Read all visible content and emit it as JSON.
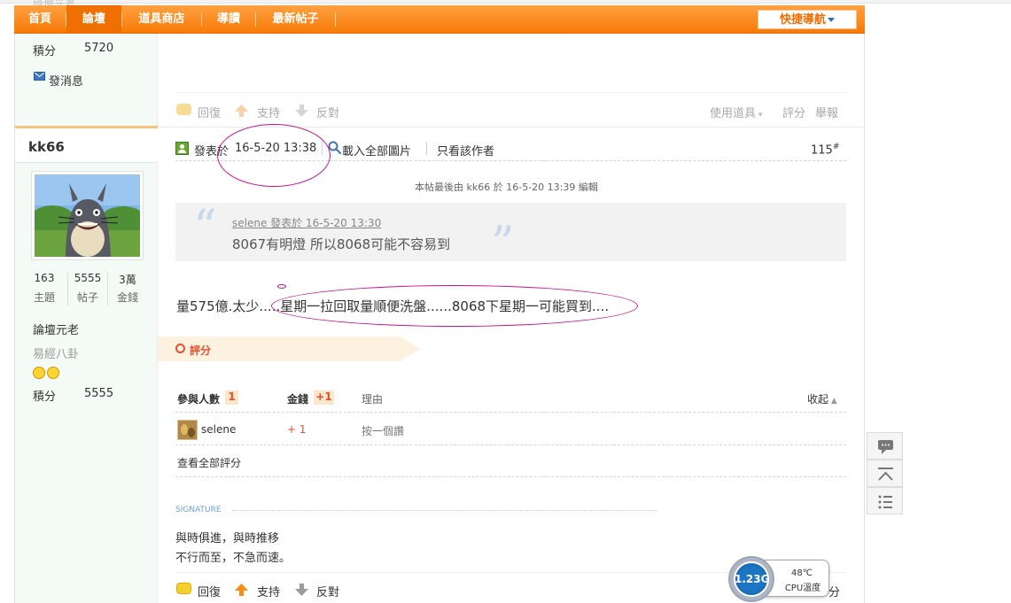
{
  "ghost_text": "論壇元老",
  "nav": {
    "items": [
      {
        "label": "首頁"
      },
      {
        "label": "論壇"
      },
      {
        "label": "道具商店"
      },
      {
        "label": "導讀"
      },
      {
        "label": "最新帖子"
      }
    ],
    "quick_nav": "快捷導航"
  },
  "prev_user": {
    "points_label": "積分",
    "points_value": "5720",
    "message_label": "發消息"
  },
  "prev_post_actions": {
    "reply": "回復",
    "support": "支持",
    "oppose": "反對",
    "use_item": "使用道具",
    "rate": "評分",
    "report": "舉報"
  },
  "user": {
    "name": "kk66",
    "stats": [
      {
        "value": "163",
        "label": "主題"
      },
      {
        "value": "5555",
        "label": "帖子"
      },
      {
        "value": "3萬",
        "label": "金錢"
      }
    ],
    "rank": "論壇元老",
    "group": "易經八卦",
    "points_label": "積分",
    "points_value": "5555"
  },
  "post": {
    "posted_label": "發表於",
    "posted_time": "16-5-20 13:38",
    "load_images": "載入全部圖片",
    "only_author": "只看該作者",
    "floor": "115",
    "floor_suffix": "#",
    "edited_note": "本帖最後由 kk66 於 16-5-20 13:39 編輯",
    "quote_meta": "selene 發表於 16-5-20 13:30",
    "quote_text": "8067有明燈 所以8068可能不容易到",
    "body_prefix": "量575億.太少.....",
    "body_highlight": "星期一拉回取量順便洗盤......8068下星期一可能買到...."
  },
  "rating": {
    "title": "評分",
    "headers": {
      "participants": "參與人數",
      "participants_count": "1",
      "money": "金錢",
      "money_count": "+1",
      "reason": "理由",
      "collapse": "收起"
    },
    "rows": [
      {
        "user": "selene",
        "money": "+ 1",
        "reason": "按一個讚"
      }
    ],
    "view_all": "查看全部評分"
  },
  "signature": {
    "label": "SIGNATURE",
    "line1": "與時俱進，與時推移",
    "line2": "不行而至，不急而速。"
  },
  "bottom_actions": {
    "reply": "回復",
    "support": "支持",
    "oppose": "反對",
    "rate_fragment": "分"
  },
  "cpu": {
    "frequency": "1.23G",
    "temperature": "48℃",
    "label": "CPU溫度"
  },
  "colors": {
    "nav_orange": "#f77a06",
    "accent_red": "#e44f2f",
    "highlight_ellipse": "#c8128c",
    "sidebar_bg": "#f4fbf6"
  }
}
